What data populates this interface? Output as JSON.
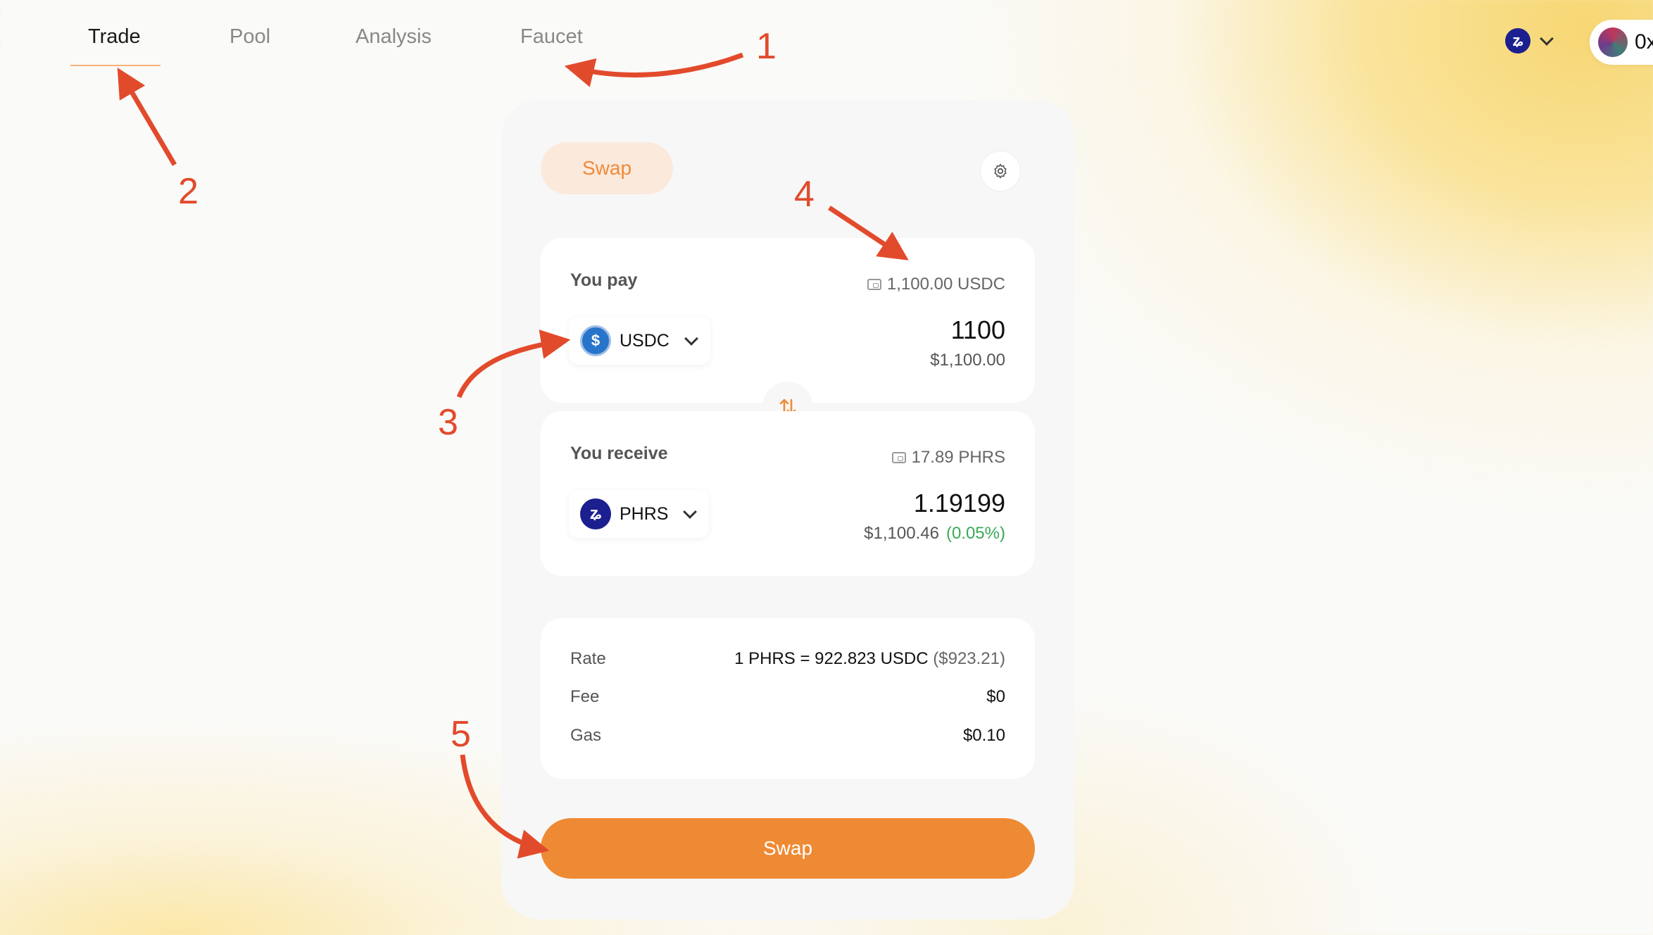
{
  "nav": {
    "items": [
      {
        "label": "Trade",
        "active": true
      },
      {
        "label": "Pool",
        "active": false
      },
      {
        "label": "Analysis",
        "active": false
      },
      {
        "label": "Faucet",
        "active": false
      }
    ]
  },
  "header": {
    "chain_icon": "pharos-logo-icon",
    "wallet_text": "0x"
  },
  "card": {
    "tab_label": "Swap",
    "settings_icon": "gear-icon",
    "pay": {
      "label": "You pay",
      "balance": "1,100.00 USDC",
      "token": "USDC",
      "amount": "1100",
      "usd_value": "$1,100.00"
    },
    "receive": {
      "label": "You receive",
      "balance": "17.89 PHRS",
      "token": "PHRS",
      "amount": "1.19199",
      "usd_value": "$1,100.46",
      "price_impact": "(0.05%)"
    },
    "details": {
      "rate_label": "Rate",
      "rate_value": "1 PHRS = 922.823 USDC",
      "rate_usd": "($923.21)",
      "fee_label": "Fee",
      "fee_value": "$0",
      "gas_label": "Gas",
      "gas_value": "$0.10"
    },
    "swap_button": "Swap"
  },
  "annotations": [
    "1",
    "2",
    "3",
    "4",
    "5"
  ],
  "colors": {
    "accent": "#ef8a34",
    "annotation": "#e24a2c",
    "positive": "#3aa956"
  }
}
